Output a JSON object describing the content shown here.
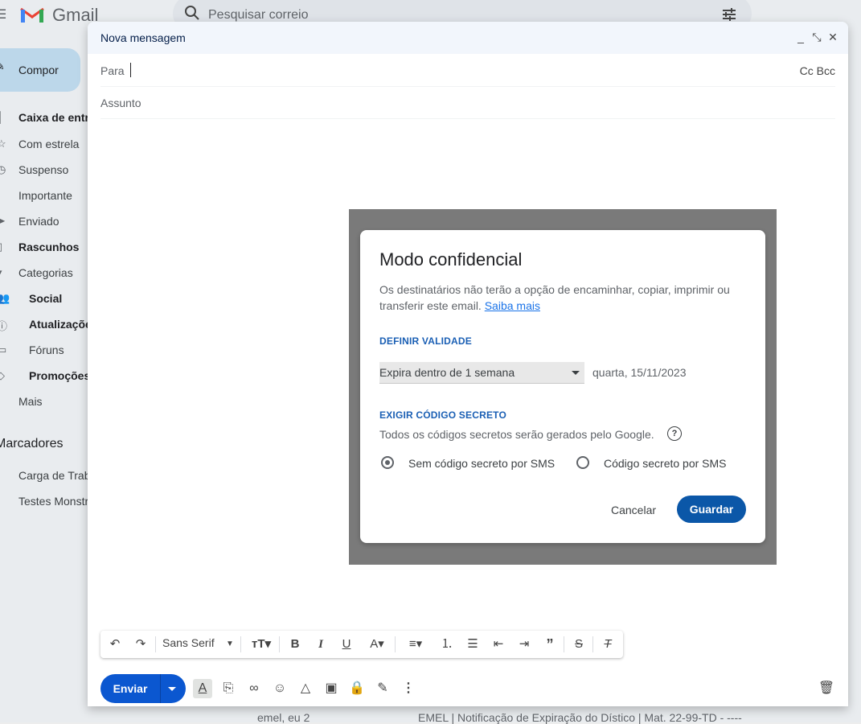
{
  "app": {
    "name": "Gmail"
  },
  "search": {
    "placeholder": "Pesquisar correio"
  },
  "compose_button": {
    "label": "Compor"
  },
  "nav": {
    "items": [
      {
        "label": "Caixa de entrada",
        "icon": "inbox-icon",
        "bold": true
      },
      {
        "label": "Com estrela",
        "icon": "star-icon"
      },
      {
        "label": "Suspenso",
        "icon": "clock-icon"
      },
      {
        "label": "Importante",
        "icon": "label-important-icon"
      },
      {
        "label": "Enviado",
        "icon": "send-icon"
      },
      {
        "label": "Rascunhos",
        "icon": "draft-icon",
        "bold": true
      },
      {
        "label": "Categorias",
        "icon": "chevron-icon"
      },
      {
        "label": "Social",
        "icon": "people-icon",
        "bold": true
      },
      {
        "label": "Atualizações",
        "icon": "info-icon",
        "bold": true
      },
      {
        "label": "Fóruns",
        "icon": "forum-icon"
      },
      {
        "label": "Promoções",
        "icon": "tag-icon",
        "bold": true
      },
      {
        "label": "Mais",
        "icon": ""
      }
    ],
    "labels_title": "Marcadores",
    "labels": [
      {
        "label": "Carga de Trabalho"
      },
      {
        "label": "Testes Monstro"
      }
    ]
  },
  "background_row": {
    "sender": "emel, eu 2",
    "subject": "EMEL | Notificação de Expiração do Dístico | Mat. 22-99-TD - ----"
  },
  "compose": {
    "title": "Nova mensagem",
    "to_label": "Para",
    "cc_bcc": "Cc Bcc",
    "subject_placeholder": "Assunto"
  },
  "dialog": {
    "title": "Modo confidencial",
    "description": "Os destinatários não terão a opção de encaminhar, copiar, imprimir ou transferir este email.",
    "learn_more": "Saiba mais",
    "expiry_section": "DEFINIR VALIDADE",
    "expiry_selected": "Expira dentro de 1 semana",
    "expiry_date": "quarta, 15/11/2023",
    "code_section": "EXIGIR CÓDIGO SECRETO",
    "code_description": "Todos os códigos secretos serão gerados pelo Google.",
    "radio_no_sms": "Sem código secreto por SMS",
    "radio_sms": "Código secreto por SMS",
    "selected_option": "Sem código secreto por SMS",
    "cancel": "Cancelar",
    "save": "Guardar"
  },
  "format_toolbar": {
    "font": "Sans Serif"
  },
  "send": {
    "label": "Enviar"
  },
  "colors": {
    "send_blue": "#0b57d0",
    "save_blue": "#0b57a8",
    "link_blue": "#1a73e8",
    "section_blue": "#1a5fb4"
  }
}
